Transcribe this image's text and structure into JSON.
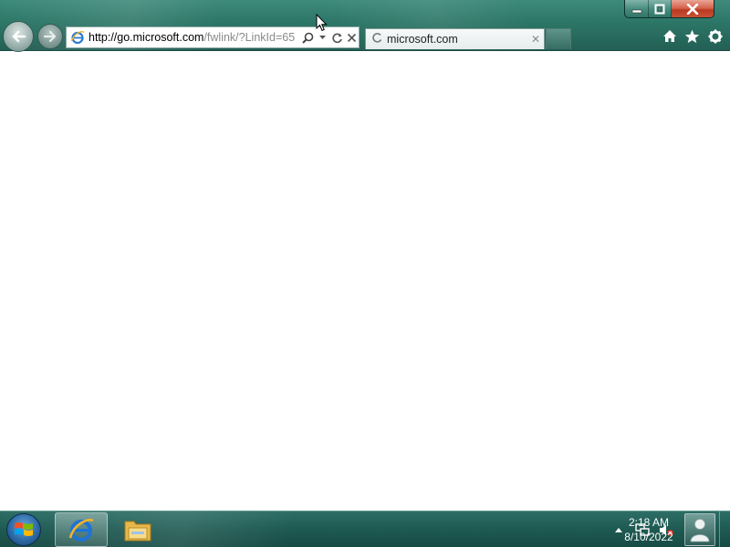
{
  "browser": {
    "address_bar": {
      "url_main": "http://go.microsoft.com",
      "url_dim": "/fwlink/?LinkId=65",
      "icons": [
        "ie-page-icon",
        "search-icon",
        "dropdown-icon",
        "refresh-icon",
        "stop-icon"
      ]
    },
    "tab": {
      "title": "microsoft.com",
      "status": "loading"
    },
    "toolbar": [
      "home-icon",
      "favorites-star-icon",
      "tools-gear-icon"
    ]
  },
  "taskbar": {
    "pinned": [
      "internet-explorer-icon",
      "windows-explorer-icon"
    ],
    "tray": [
      "show-hidden-icons-arrow",
      "network-icon",
      "volume-muted-icon"
    ],
    "clock": {
      "time": "2:18 AM",
      "date": "8/10/2022"
    }
  }
}
